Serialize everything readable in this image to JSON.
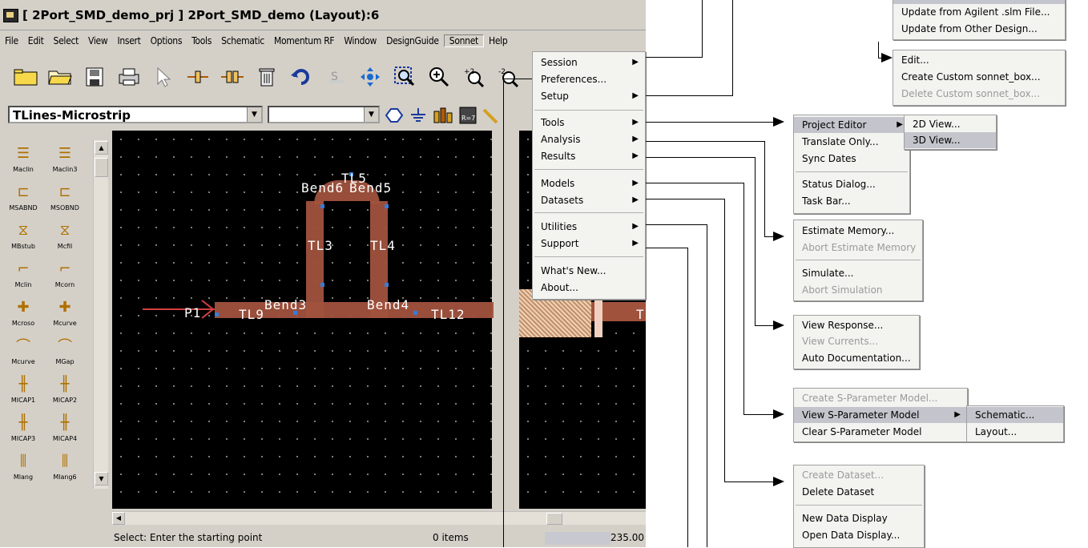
{
  "window": {
    "title": "[ 2Port_SMD_demo_prj ] 2Port_SMD_demo (Layout):6"
  },
  "menubar": [
    "File",
    "Edit",
    "Select",
    "View",
    "Insert",
    "Options",
    "Tools",
    "Schematic",
    "Momentum RF",
    "Window",
    "DesignGuide",
    "Sonnet",
    "Help"
  ],
  "toolbar": {
    "combo_component": "TLines-Microstrip",
    "combo_second": ""
  },
  "palette": [
    [
      "Maclin",
      "Maclin3"
    ],
    [
      "MSABND",
      "MSOBND"
    ],
    [
      "MBstub",
      "Mcfil"
    ],
    [
      "Mclin",
      "Mcorn"
    ],
    [
      "Mcroso",
      "Mcurve"
    ],
    [
      "Mcurve",
      "MGap"
    ],
    [
      "MICAP1",
      "MICAP2"
    ],
    [
      "MICAP3",
      "MICAP4"
    ],
    [
      "Mlang",
      "Mlang6"
    ]
  ],
  "canvas_labels": {
    "tl5": "TL5",
    "bend6": "Bend6",
    "bend5": "Bend5",
    "tl3": "TL3",
    "tl4": "TL4",
    "p1": "P1",
    "tl9": "TL9",
    "bend3": "Bend3",
    "bend4": "Bend4",
    "tl12": "TL12",
    "t": "T"
  },
  "status": {
    "prompt": "Select: Enter the starting point",
    "items": "0 items",
    "coord": "235.00"
  },
  "sonnet_menu": {
    "groups": [
      [
        "Session",
        "Preferences...",
        "Setup"
      ],
      [
        "Tools",
        "Analysis",
        "Results"
      ],
      [
        "Models",
        "Datasets"
      ],
      [
        "Utilities",
        "Support"
      ],
      [
        "What's New...",
        "About..."
      ]
    ]
  },
  "session_submenu": {
    "top": [
      "Update from Agilent .slm File...",
      "Update from Other Design..."
    ],
    "bottom": [
      "Edit...",
      "Create Custom sonnet_box...",
      "Delete Custom sonnet_box..."
    ]
  },
  "tools_submenu": {
    "items": [
      "Project Editor",
      "Translate Only...",
      "Sync Dates",
      "Status Dialog...",
      "Task Bar..."
    ],
    "sub": [
      "2D View...",
      "3D View..."
    ]
  },
  "analysis_submenu": [
    "Estimate Memory...",
    "Abort Estimate Memory",
    "Simulate...",
    "Abort Simulation"
  ],
  "results_submenu": [
    "View Response...",
    "View Currents...",
    "Auto Documentation..."
  ],
  "models_submenu": {
    "items": [
      "Create S-Parameter Model...",
      "View S-Parameter Model",
      "Clear S-Parameter Model"
    ],
    "sub": [
      "Schematic...",
      "Layout..."
    ]
  },
  "datasets_submenu": [
    "Create Dataset...",
    "Delete Dataset",
    "New Data Display",
    "Open Data Display..."
  ]
}
